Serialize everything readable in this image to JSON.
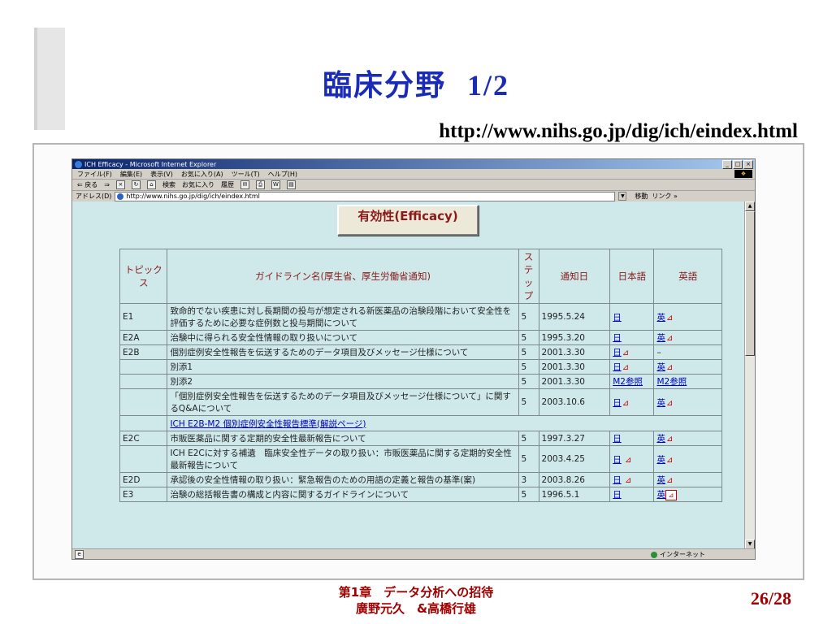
{
  "slide": {
    "title": "臨床分野",
    "title_part": "1/2",
    "url": "http://www.nihs.go.jp/dig/ich/eindex.html",
    "footer_line1": "第1章　データ分析への招待",
    "footer_line2": "廣野元久　&高橋行雄",
    "page_number": "26/28"
  },
  "browser": {
    "window_title": "ICH Efficacy - Microsoft Internet Explorer",
    "menu": [
      "ファイル(F)",
      "編集(E)",
      "表示(V)",
      "お気に入り(A)",
      "ツール(T)",
      "ヘルプ(H)"
    ],
    "toolbar": [
      "⇐ 戻る",
      "⇒",
      "検索",
      "お気に入り",
      "履歴"
    ],
    "address_label": "アドレス(D)",
    "address_value": "http://www.nihs.go.jp/dig/ich/eindex.html",
    "go_label": "移動",
    "links_label": "リンク »",
    "status_zone": "インターネット"
  },
  "page": {
    "banner": "有効性(Efficacy)",
    "headers": {
      "topic": "トピックス",
      "guideline": "ガイドライン名(厚生省、厚生労働省通知)",
      "step": "ステップ",
      "date": "通知日",
      "ja": "日本語",
      "en": "英語"
    },
    "rows": [
      {
        "topic": "E1",
        "name": "致命的でない疾患に対し長期間の投与が想定される新医薬品の治験段階において安全性を評価するために必要な症例数と投与期間について",
        "step": "5",
        "date": "1995.5.24",
        "ja": "日",
        "en": "英"
      },
      {
        "topic": "E2A",
        "name": "治験中に得られる安全性情報の取り扱いについて",
        "step": "5",
        "date": "1995.3.20",
        "ja": "日",
        "en": "英"
      },
      {
        "topic": "E2B",
        "name": "個別症例安全性報告を伝送するためのデータ項目及びメッセージ仕様について",
        "step": "5",
        "date": "2001.3.30",
        "ja": "日",
        "en": "–"
      },
      {
        "topic": "",
        "name": "別添1",
        "step": "5",
        "date": "2001.3.30",
        "ja": "日",
        "en": "英"
      },
      {
        "topic": "",
        "name": "別添2",
        "step": "5",
        "date": "2001.3.30",
        "ja": "M2参照",
        "en": "M2参照"
      },
      {
        "topic": "",
        "name": "「個別症例安全性報告を伝送するためのデータ項目及びメッセージ仕様について」に関するQ&Aについて",
        "step": "5",
        "date": "2003.10.6",
        "ja": "日",
        "en": "英"
      },
      {
        "topic": "",
        "name": "ICH E2B-M2 個別症例安全性報告標準(解説ページ)",
        "step": "",
        "date": "",
        "ja": "",
        "en": ""
      },
      {
        "topic": "E2C",
        "name": "市販医薬品に関する定期的安全性最新報告について",
        "step": "5",
        "date": "1997.3.27",
        "ja": "日",
        "en": "英"
      },
      {
        "topic": "",
        "name": "ICH E2Cに対する補遺　臨床安全性データの取り扱い：市販医薬品に関する定期的安全性最新報告について",
        "step": "5",
        "date": "2003.4.25",
        "ja": "日",
        "en": "英"
      },
      {
        "topic": "E2D",
        "name": "承認後の安全性情報の取り扱い：緊急報告のための用語の定義と報告の基準(案)",
        "step": "3",
        "date": "2003.8.26",
        "ja": "日",
        "en": "英"
      },
      {
        "topic": "E3",
        "name": "治験の総括報告書の構成と内容に関するガイドラインについて",
        "step": "5",
        "date": "1996.5.1",
        "ja": "日",
        "en": "英"
      }
    ]
  },
  "colors": {
    "title": "#1a2bb8",
    "footer": "#a00000",
    "banner_text": "#8b1a1a",
    "page_bg": "#cfe8ea",
    "link": "#0000c0"
  }
}
